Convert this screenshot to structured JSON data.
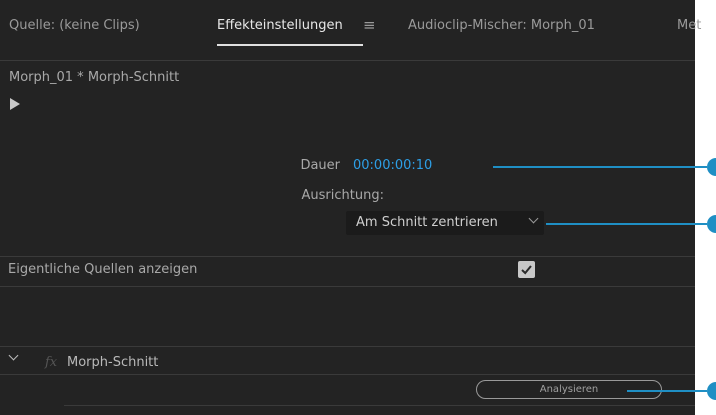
{
  "tabs": [
    {
      "label": "Quelle: (keine Clips)"
    },
    {
      "label": "Effekteinstellungen"
    },
    {
      "label": "Audioclip-Mischer: Morph_01"
    },
    {
      "label": "Met"
    }
  ],
  "menu_icon": "hamburger-icon",
  "clip_title": "Morph_01 * Morph-Schnitt",
  "duration": {
    "label": "Dauer",
    "value": "00:00:00:10"
  },
  "alignment": {
    "label": "Ausrichtung:",
    "selected": "Am Schnitt zentrieren"
  },
  "show_sources": {
    "label": "Eigentliche Quellen anzeigen",
    "checked": true
  },
  "effect": {
    "fx_symbol": "fx",
    "name": "Morph-Schnitt"
  },
  "analyze_label": "Analysieren",
  "colors": {
    "panel_bg": "#232323",
    "accent_blue": "#2d9fe6",
    "callout": "#1f8fc4"
  }
}
